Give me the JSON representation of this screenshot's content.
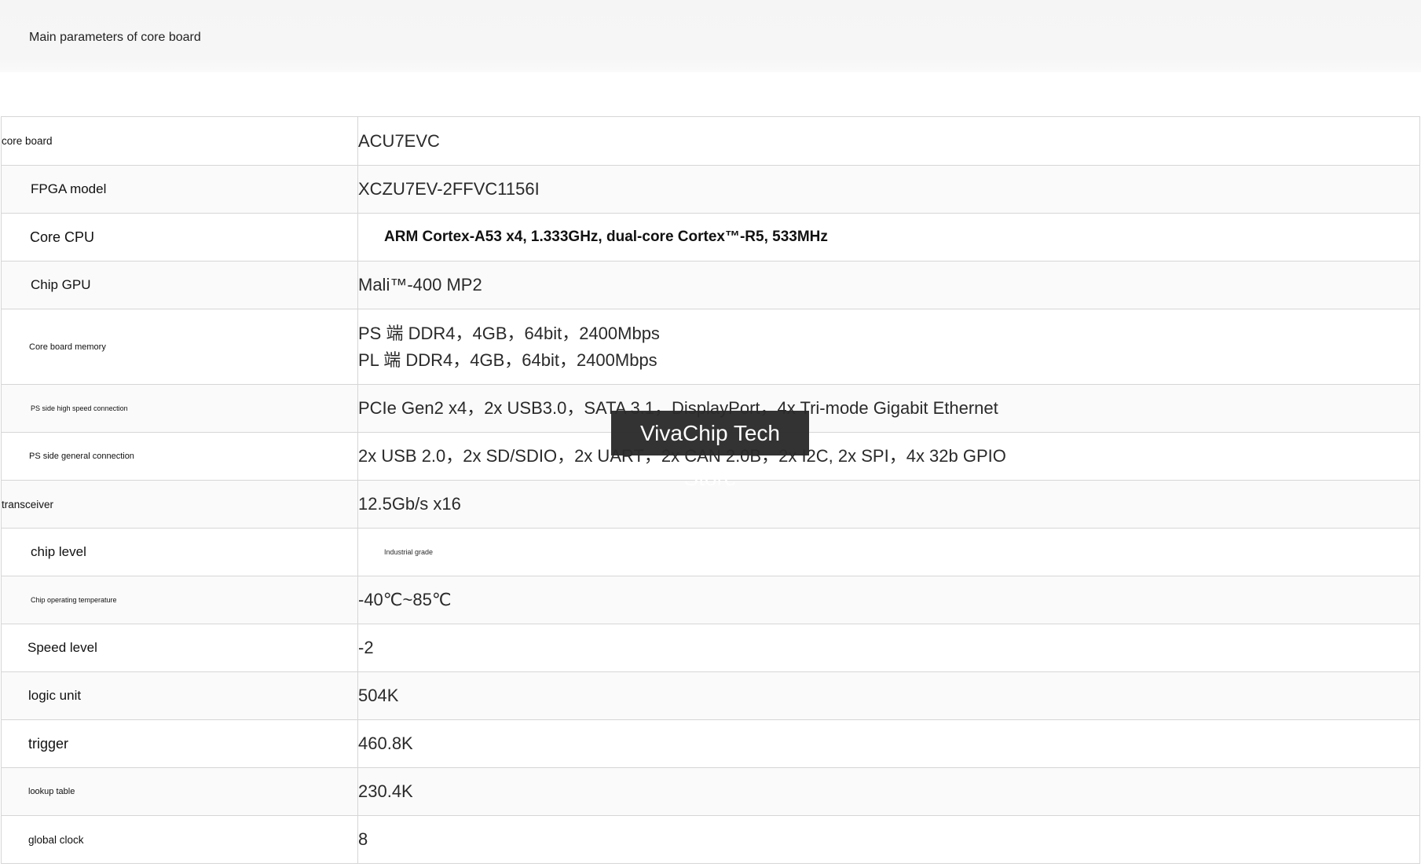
{
  "header": {
    "title": "Main parameters of core board"
  },
  "table": {
    "rows": [
      {
        "label": "core board",
        "value": [
          "ACU7EVC"
        ]
      },
      {
        "label": "FPGA model",
        "value": [
          "XCZU7EV-2FFVC1156I"
        ]
      },
      {
        "label": "Core CPU",
        "value": [
          "ARM Cortex-A53 x4, 1.333GHz, dual-core Cortex™-R5, 533MHz"
        ]
      },
      {
        "label": "Chip GPU",
        "value": [
          "Mali™-400 MP2"
        ]
      },
      {
        "label": "Core board memory",
        "value": [
          "PS 端 DDR4，4GB，64bit，2400Mbps",
          "PL 端 DDR4，4GB，64bit，2400Mbps"
        ]
      },
      {
        "label": "PS side high speed connection",
        "value": [
          "PCIe Gen2 x4，2x USB3.0，SATA 3.1，DisplayPort，4x Tri-mode Gigabit Ethernet"
        ]
      },
      {
        "label": "PS side general connection",
        "value": [
          "2x USB 2.0，2x SD/SDIO，2x UART，2x CAN 2.0B，2x I2C, 2x SPI，4x 32b GPIO"
        ]
      },
      {
        "label": "transceiver",
        "value": [
          "12.5Gb/s x16"
        ]
      },
      {
        "label": "chip level",
        "value": [
          "Industrial grade"
        ]
      },
      {
        "label": "Chip operating temperature",
        "value": [
          "-40℃~85℃"
        ]
      },
      {
        "label": "Speed level",
        "value": [
          "-2"
        ]
      },
      {
        "label": "logic unit",
        "value": [
          "504K"
        ]
      },
      {
        "label": "trigger",
        "value": [
          "460.8K"
        ]
      },
      {
        "label": "lookup table",
        "value": [
          "230.4K"
        ]
      },
      {
        "label": "global clock",
        "value": [
          "8"
        ]
      }
    ]
  },
  "watermark": {
    "text": "VivaChip Tech Store"
  }
}
